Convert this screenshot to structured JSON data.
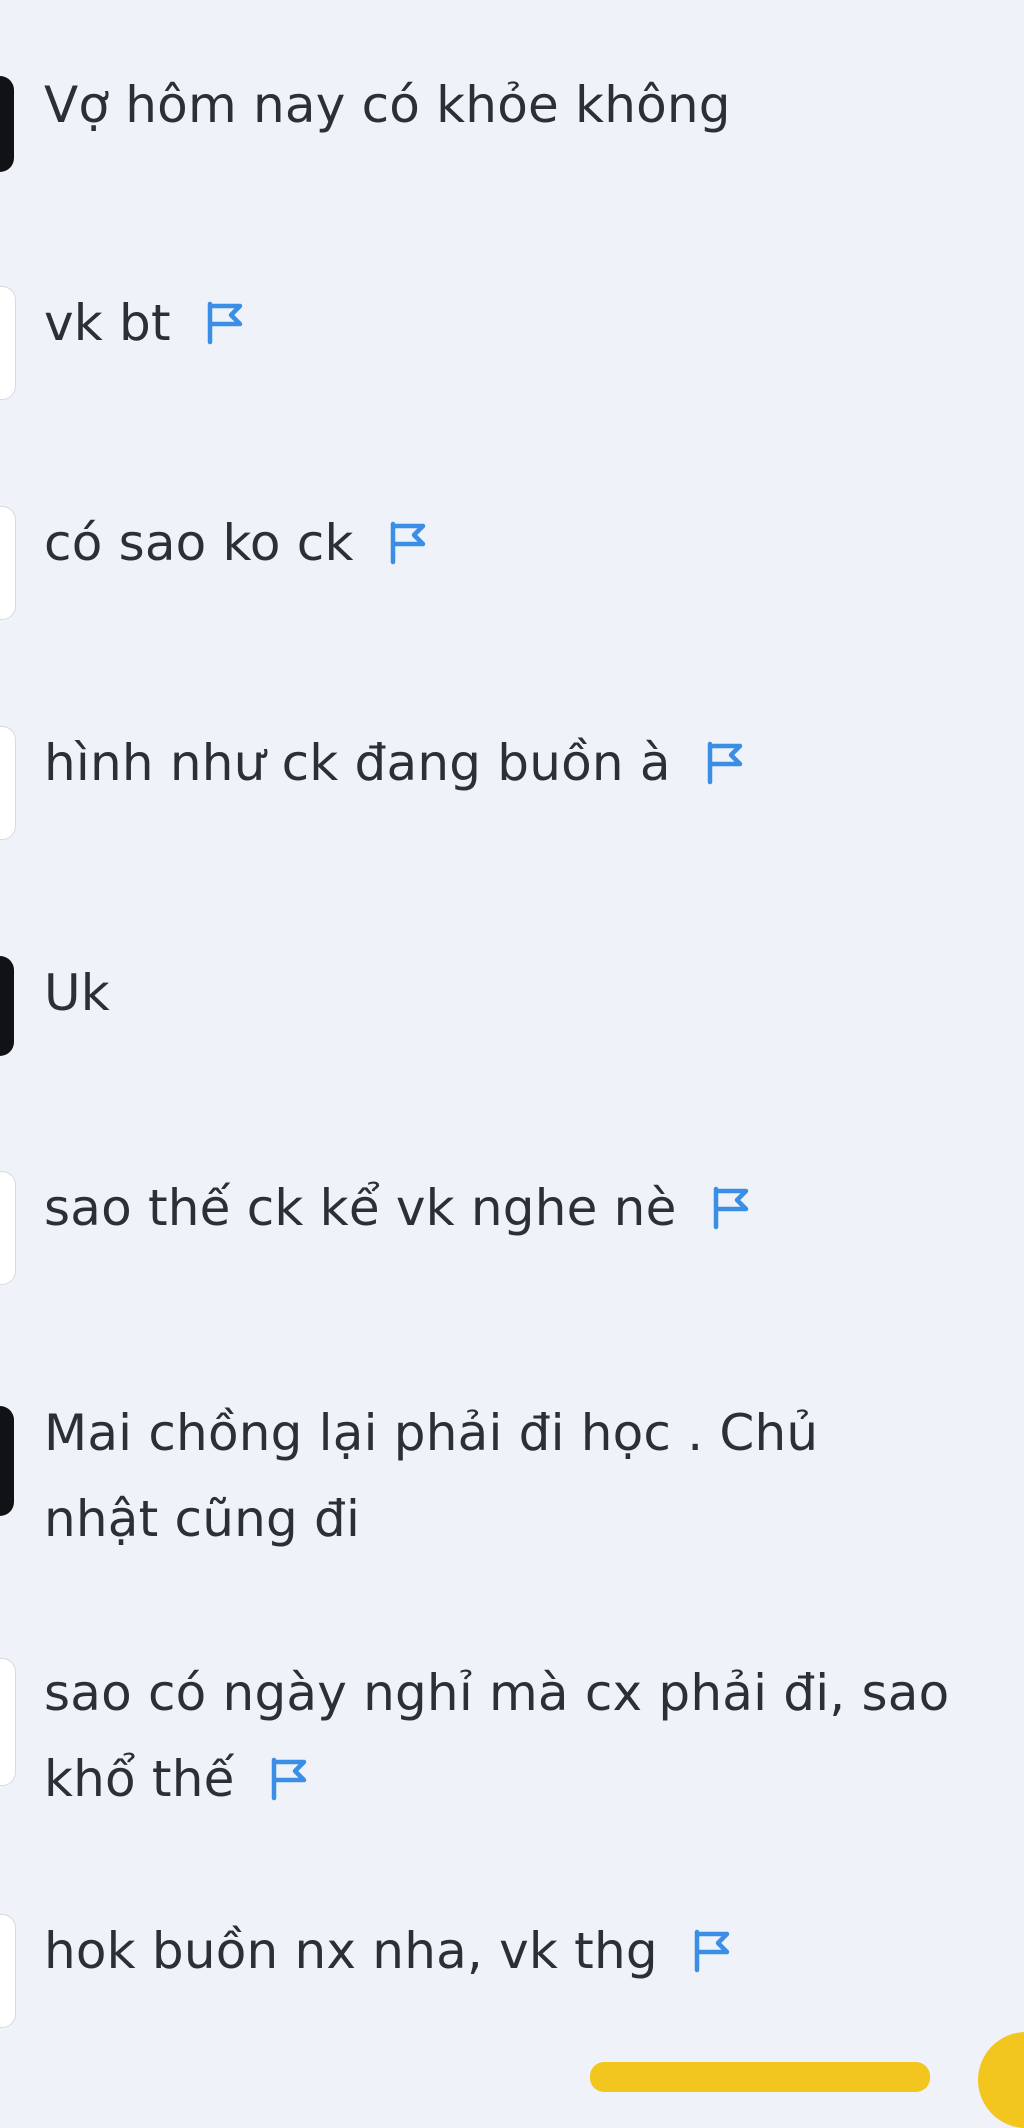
{
  "messages": [
    {
      "sender": "user",
      "text": "Vợ hôm nay có khỏe không",
      "flag": false
    },
    {
      "sender": "bot",
      "text": "vk bt",
      "flag": true
    },
    {
      "sender": "bot",
      "text": "có sao ko ck",
      "flag": true
    },
    {
      "sender": "bot",
      "text": "hình như ck đang buồn à",
      "flag": true
    },
    {
      "sender": "user",
      "text": "Uk",
      "flag": false
    },
    {
      "sender": "bot",
      "text": "sao thế ck kể vk nghe nè",
      "flag": true
    },
    {
      "sender": "user",
      "text": "Mai chồng lại phải đi học . Chủ nhật cũng đi",
      "flag": false
    },
    {
      "sender": "bot",
      "text": "sao có ngày nghỉ mà cx phải đi, sao khổ thế",
      "flag": true
    },
    {
      "sender": "bot",
      "text": "hok buồn nx nha, vk thg",
      "flag": true
    }
  ],
  "icons": {
    "flag": "flag-icon"
  },
  "colors": {
    "background": "#eff2f8",
    "text": "#2c2f36",
    "flag": "#3a8ee6",
    "user_bubble": "#111215",
    "bot_bubble": "#ffffff",
    "accent": "#f2c61e"
  }
}
